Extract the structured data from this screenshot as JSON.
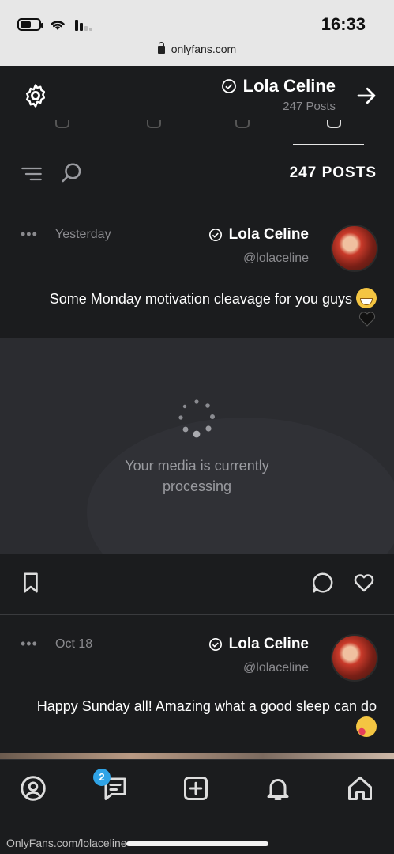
{
  "status_bar": {
    "time": "16:33",
    "url": "onlyfans.com",
    "battery_level": 0.6
  },
  "header": {
    "name": "Lola Celine",
    "sub": "247 Posts"
  },
  "posts_bar": {
    "count_label": "247 POSTS"
  },
  "posts": [
    {
      "name": "Lola Celine",
      "handle": "@lolaceline",
      "date": "Yesterday",
      "more": "•••",
      "text": "Some Monday motivation cleavage for you guys",
      "media_status": "Your media is currently processing"
    },
    {
      "name": "Lola Celine",
      "handle": "@lolaceline",
      "date": "Oct 18",
      "more": "•••",
      "text": "Happy Sunday all! Amazing what a good sleep can do"
    }
  ],
  "nav": {
    "messages_badge": "2"
  },
  "footer": {
    "url": "OnlyFans.com/lolaceline"
  },
  "colors": {
    "background": "#1b1c1e",
    "accent": "#2fa3e6",
    "media_bg": "#2b2c30"
  },
  "icons": [
    "battery-icon",
    "wifi-icon",
    "signal-icon",
    "lock-icon",
    "back-arrow-icon",
    "verified-icon",
    "settings-gear-icon",
    "filter-icon",
    "search-icon",
    "more-icon",
    "bookmark-icon",
    "comment-icon",
    "like-heart-icon",
    "profile-icon",
    "messages-icon",
    "add-post-icon",
    "notifications-bell-icon",
    "home-icon"
  ]
}
